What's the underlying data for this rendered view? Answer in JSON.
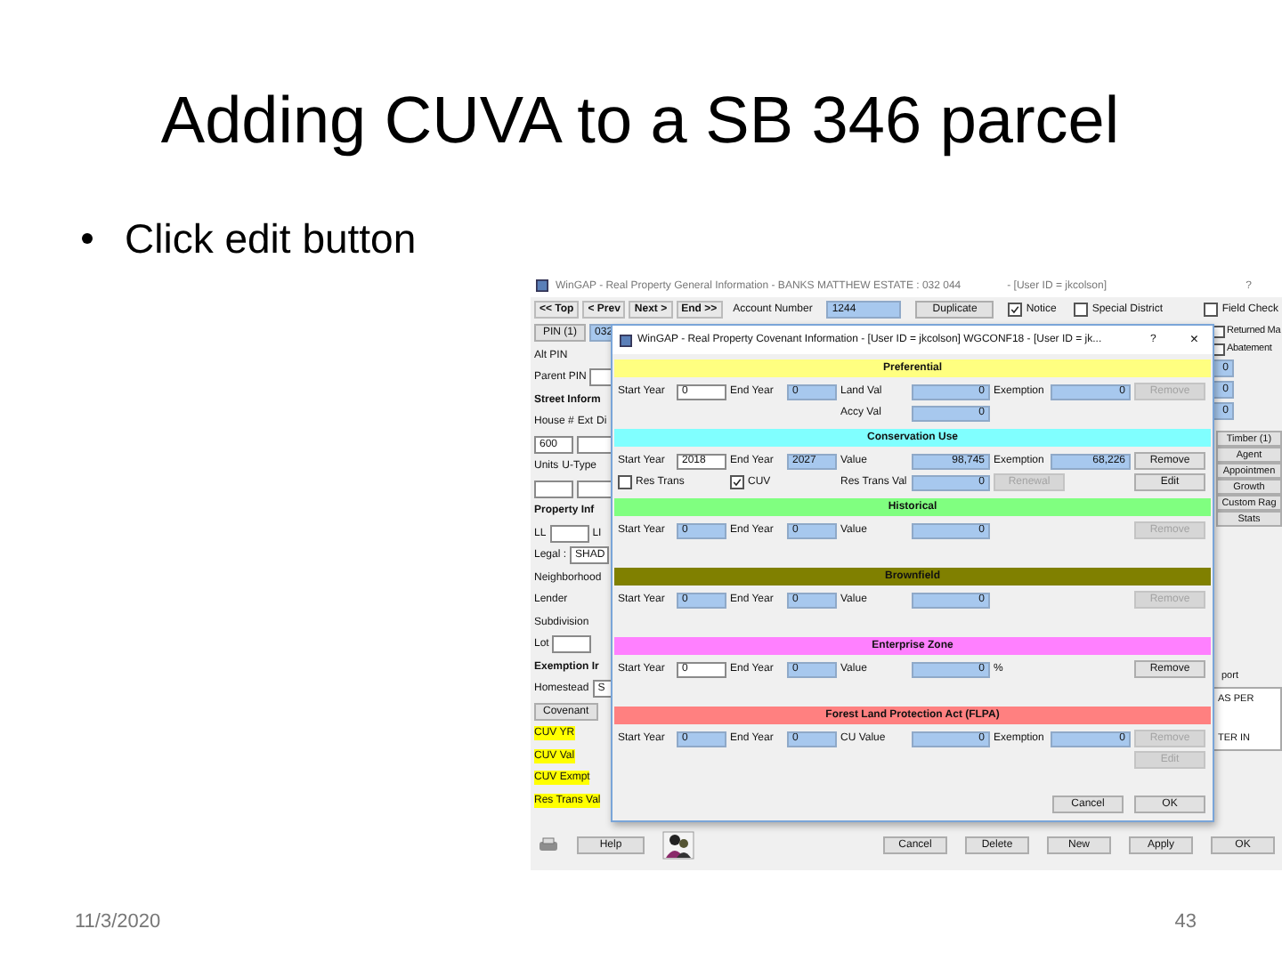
{
  "slide": {
    "title": "Adding CUVA to a SB 346 parcel",
    "bullets": [
      "Click edit button"
    ],
    "date": "11/3/2020",
    "page": "43"
  },
  "main_window": {
    "title": "WinGAP - Real Property General Information - BANKS MATTHEW ESTATE : 032   044",
    "user": "- [User ID = jkcolson]",
    "help": "?",
    "nav_buttons": [
      "<< Top",
      "< Prev",
      "Next >",
      "End >>"
    ],
    "account_label": "Account Number",
    "account_value": "1244",
    "duplicate": "Duplicate",
    "checks": [
      {
        "label": "Notice",
        "checked": true
      },
      {
        "label": "Special District",
        "checked": false
      },
      {
        "label": "Field Check",
        "checked": false
      }
    ],
    "left_rows": [
      [
        {
          "kind": "button",
          "text": "PIN (1)"
        },
        {
          "kind": "readonly",
          "text": "032"
        }
      ],
      [
        {
          "kind": "text",
          "text": "Alt PIN"
        }
      ],
      [
        {
          "kind": "text",
          "text": "Parent PIN"
        },
        {
          "kind": "field"
        }
      ],
      [
        {
          "kind": "heading",
          "text": "Street Inform"
        }
      ],
      [
        {
          "kind": "text",
          "text": "House #"
        },
        {
          "kind": "text",
          "text": "Ext"
        },
        {
          "kind": "text",
          "text": "Di"
        }
      ],
      [
        {
          "kind": "field",
          "text": "600"
        },
        {
          "kind": "field"
        }
      ],
      [
        {
          "kind": "text",
          "text": "Units"
        },
        {
          "kind": "text",
          "text": "U-Type"
        }
      ],
      [
        {
          "kind": "field"
        },
        {
          "kind": "field"
        }
      ],
      [
        {
          "kind": "heading",
          "text": "Property Inf"
        }
      ],
      [
        {
          "kind": "text",
          "text": "LL"
        },
        {
          "kind": "field"
        },
        {
          "kind": "text",
          "text": "LI"
        }
      ],
      [
        {
          "kind": "text",
          "text": "Legal :"
        },
        {
          "kind": "field",
          "text": "SHAD"
        }
      ],
      [
        {
          "kind": "text",
          "text": "Neighborhood"
        }
      ],
      [
        {
          "kind": "text",
          "text": "Lender"
        }
      ],
      [
        {
          "kind": "text",
          "text": "Subdivision"
        }
      ],
      [
        {
          "kind": "text",
          "text": "Lot"
        },
        {
          "kind": "field"
        }
      ],
      [
        {
          "kind": "heading",
          "text": "Exemption Ir"
        }
      ],
      [
        {
          "kind": "text",
          "text": "Homestead"
        },
        {
          "kind": "field",
          "text": "S"
        }
      ],
      [
        {
          "kind": "button",
          "text": "Covenant"
        }
      ],
      [
        {
          "kind": "highlight",
          "text": "CUV YR"
        }
      ],
      [
        {
          "kind": "highlight",
          "text": "CUV Val"
        }
      ],
      [
        {
          "kind": "highlight",
          "text": "CUV Exmpt"
        }
      ],
      [
        {
          "kind": "highlight",
          "text": "Res Trans Val"
        }
      ]
    ],
    "right_checks": [
      {
        "label": "Returned Ma",
        "checked": false
      },
      {
        "label": "Abatement",
        "checked": false
      }
    ],
    "right_values": [
      "0",
      "0",
      "0"
    ],
    "side_buttons": [
      "Timber (1)",
      "Agent",
      "Appointmen",
      "Growth",
      "Custom Rag",
      "Stats"
    ],
    "report_label": "port",
    "report_lines": [
      "AS PER",
      "TER IN"
    ],
    "help_button": "Help",
    "bottom_buttons": [
      "Cancel",
      "Delete",
      "New",
      "Apply",
      "OK"
    ]
  },
  "dialog": {
    "title": "WinGAP - Real Property Covenant Information - [User ID = jkcolson] WGCONF18 - [User ID = jk...",
    "help": "?",
    "close": "×",
    "sections": [
      {
        "title": "Preferential",
        "color": "#ffff80",
        "rows": [
          [
            {
              "kind": "label",
              "text": "Start Year"
            },
            {
              "kind": "input",
              "text": "0"
            },
            {
              "kind": "label",
              "text": "End Year"
            },
            {
              "kind": "readonly",
              "text": "0"
            },
            {
              "kind": "label",
              "text": "Land Val"
            },
            {
              "kind": "readonly",
              "text": "0"
            },
            {
              "kind": "label",
              "text": "Exemption"
            },
            {
              "kind": "readonly",
              "text": "0"
            },
            {
              "kind": "button",
              "text": "Remove",
              "disabled": true
            }
          ],
          [
            "",
            "",
            "",
            "",
            {
              "kind": "label",
              "text": "Accy Val"
            },
            {
              "kind": "readonly",
              "text": "0"
            }
          ]
        ]
      },
      {
        "title": "Conservation Use",
        "color": "#80ffff",
        "rows": [
          [
            {
              "kind": "label",
              "text": "Start Year"
            },
            {
              "kind": "input",
              "text": "2018"
            },
            {
              "kind": "label",
              "text": "End Year"
            },
            {
              "kind": "readonly",
              "text": "2027"
            },
            {
              "kind": "label",
              "text": "Value"
            },
            {
              "kind": "readonly",
              "text": "98,745"
            },
            {
              "kind": "label",
              "text": "Exemption"
            },
            {
              "kind": "readonly",
              "text": "68,226"
            },
            {
              "kind": "button",
              "text": "Remove",
              "disabled": false
            }
          ],
          [
            {
              "kind": "check",
              "text": "Res Trans",
              "checked": false
            },
            "",
            {
              "kind": "check",
              "text": "CUV",
              "checked": true
            },
            "",
            {
              "kind": "label",
              "text": "Res Trans Val"
            },
            {
              "kind": "readonly",
              "text": "0"
            },
            {
              "kind": "button",
              "text": "Renewal",
              "disabled": true
            },
            "",
            {
              "kind": "button",
              "text": "Edit",
              "disabled": false
            }
          ]
        ]
      },
      {
        "title": "Historical",
        "color": "#80ff80",
        "rows": [
          [
            {
              "kind": "label",
              "text": "Start Year"
            },
            {
              "kind": "readonly",
              "text": "0"
            },
            {
              "kind": "label",
              "text": "End Year"
            },
            {
              "kind": "readonly",
              "text": "0"
            },
            {
              "kind": "label",
              "text": "Value"
            },
            {
              "kind": "readonly",
              "text": "0"
            },
            "",
            "",
            {
              "kind": "button",
              "text": "Remove",
              "disabled": true
            }
          ]
        ]
      },
      {
        "title": "Brownfield",
        "color": "#808000",
        "rows": [
          [
            {
              "kind": "label",
              "text": "Start Year"
            },
            {
              "kind": "readonly",
              "text": "0"
            },
            {
              "kind": "label",
              "text": "End Year"
            },
            {
              "kind": "readonly",
              "text": "0"
            },
            {
              "kind": "label",
              "text": "Value"
            },
            {
              "kind": "readonly",
              "text": "0"
            },
            "",
            "",
            {
              "kind": "button",
              "text": "Remove",
              "disabled": true
            }
          ]
        ]
      },
      {
        "title": "Enterprise Zone",
        "color": "#ff80ff",
        "rows": [
          [
            {
              "kind": "label",
              "text": "Start Year"
            },
            {
              "kind": "input",
              "text": "0"
            },
            {
              "kind": "label",
              "text": "End Year"
            },
            {
              "kind": "readonly",
              "text": "0"
            },
            {
              "kind": "label",
              "text": "Value"
            },
            {
              "kind": "readonly",
              "text": "0"
            },
            {
              "kind": "unit",
              "text": "%"
            },
            "",
            {
              "kind": "button",
              "text": "Remove",
              "disabled": false
            }
          ]
        ]
      },
      {
        "title": "Forest Land Protection Act (FLPA)",
        "color": "#ff8080",
        "rows": [
          [
            {
              "kind": "label",
              "text": "Start Year"
            },
            {
              "kind": "readonly",
              "text": "0"
            },
            {
              "kind": "label",
              "text": "End Year"
            },
            {
              "kind": "readonly",
              "text": "0"
            },
            {
              "kind": "label",
              "text": "CU Value"
            },
            {
              "kind": "readonly",
              "text": "0"
            },
            {
              "kind": "label",
              "text": "Exemption"
            },
            {
              "kind": "readonly",
              "text": "0"
            },
            {
              "kind": "button",
              "text": "Remove",
              "disabled": true
            }
          ],
          [
            "",
            "",
            "",
            "",
            "",
            "",
            "",
            "",
            {
              "kind": "button",
              "text": "Edit",
              "disabled": true
            }
          ]
        ]
      }
    ],
    "buttons": [
      "Cancel",
      "OK"
    ]
  }
}
